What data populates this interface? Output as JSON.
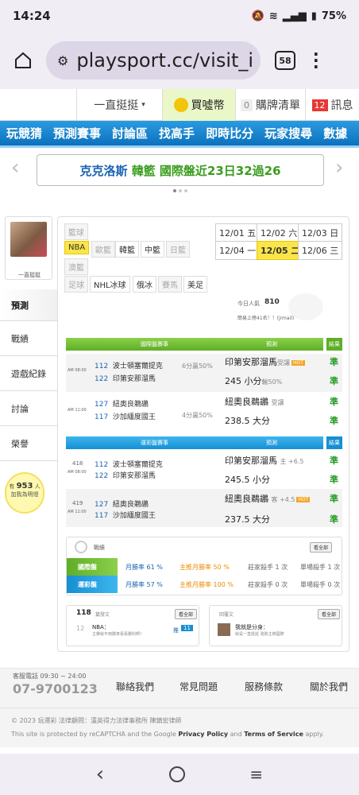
{
  "status": {
    "time": "14:24",
    "battery": "75%"
  },
  "browser": {
    "url": "playsport.cc/visit_i",
    "tab_count": "58"
  },
  "topbar": {
    "user": "一直挺挺",
    "coins": "買噓幣",
    "cart_count": "0",
    "cart": "購牌清單",
    "msg_count": "12",
    "msg": "訊息"
  },
  "nav": [
    "玩競猜",
    "預測賽事",
    "討論區",
    "找高手",
    "即時比分",
    "玩家搜尋",
    "數據"
  ],
  "banner": {
    "prefix": "克克洛斯",
    "highlight": "韓籃 國際盤近23日32過26"
  },
  "profile": {
    "name": "一直挺挺"
  },
  "sidemenu": [
    "預測",
    "戰績",
    "遊戲紀錄",
    "討論",
    "榮譽"
  ],
  "bulb": {
    "prefix": "有",
    "count": "953",
    "unit": "人",
    "line2": "加我為明燈"
  },
  "leagues": [
    "籃球",
    "NBA",
    "歐籃",
    "韓籃",
    "中籃",
    "日籃",
    "澳籃",
    "足球",
    "NHL冰球",
    "俄冰",
    "賽馬",
    "美足"
  ],
  "dates": [
    "12/01 五",
    "12/02 六",
    "12/03 日",
    "12/04 一",
    "12/05 二",
    "12/06 三"
  ],
  "today": {
    "label": "今日人氣",
    "value": "810",
    "rank": "簡易上榜41名！！(jrmail)"
  },
  "intl": {
    "header": "國際盤賽事",
    "pred": "預測",
    "result": "結果",
    "games": [
      {
        "time": "AM 08:00",
        "t1num": "112",
        "t1": "波士頓塞爾提克",
        "t2num": "122",
        "t2": "印第安那溜馬",
        "note": "6分贏50%",
        "p1": "印第安那溜馬",
        "p1tag": "受讓",
        "p2": "245 小分",
        "p2tag": "輸50%",
        "r1": "準",
        "r2": "準"
      },
      {
        "time": "AM 11:00",
        "t1num": "127",
        "t1": "紐奧良鵜鶘",
        "t2num": "117",
        "t2": "沙加緬度國王",
        "note": "4分贏50%",
        "p1": "紐奧良鵜鶘",
        "p1tag": "受讓",
        "p2": "238.5 大分",
        "p2tag": "",
        "r1": "準",
        "r2": "準"
      }
    ]
  },
  "lottery": {
    "header": "運彩盤賽事",
    "pred": "預測",
    "result": "結果",
    "games": [
      {
        "code": "418",
        "time": "AM 08:00",
        "t1num": "112",
        "t1": "波士頓塞爾提克",
        "t2num": "122",
        "t2": "印第安那溜馬",
        "p1": "印第安那溜馬",
        "p1tag": "主 +6.5",
        "p2": "245.5 小分",
        "r1": "準",
        "r2": "準"
      },
      {
        "code": "419",
        "time": "AM 11:00",
        "t1num": "127",
        "t1": "紐奧良鵜鶘",
        "t2num": "117",
        "t2": "沙加緬度國王",
        "p1": "紐奧良鵜鶘",
        "p1tag": "客 +4.5",
        "p2": "237.5 大分",
        "r1": "準",
        "r2": "準"
      }
    ]
  },
  "record": {
    "title": "戰績",
    "btn": "看全部",
    "rows": [
      {
        "tag": "國際盤",
        "month": "月勝率 61 %",
        "main": "主推月勝率 50 %",
        "streak": "莊家殺手 1 次",
        "single": "單場殺手 1 次"
      },
      {
        "tag": "運彩盤",
        "month": "月勝率 57 %",
        "main": "主推月勝率 100 %",
        "streak": "莊家殺手 0 次",
        "single": "單場殺手 0 次"
      }
    ]
  },
  "posts": {
    "count": "118",
    "label": "篇發文",
    "btn": "看全部",
    "day": "12",
    "post_title": "NBA：",
    "post_sub": "主推就不用勝率看看勝利啊！",
    "num": "11"
  },
  "replies": {
    "label": "回覆文",
    "btn": "看全部",
    "title": "我就是分身：",
    "sub": "就是一直挺挺 強勢主推國際"
  },
  "footer": {
    "tel_label": "客服電話 09:30 ~ 24:00",
    "tel": "07-9700123",
    "links": [
      "聯絡我們",
      "常見問題",
      "服務條款",
      "關於我們"
    ],
    "copyright": "© 2023 玩運彩 法律顧問：漢英得力法律事務所 陳鎮宏律師",
    "recaptcha_pre": "This site is protected by reCAPTCHA and the Google",
    "privacy": "Privacy Policy",
    "and": "and",
    "terms": "Terms of Service",
    "apply": "apply."
  }
}
